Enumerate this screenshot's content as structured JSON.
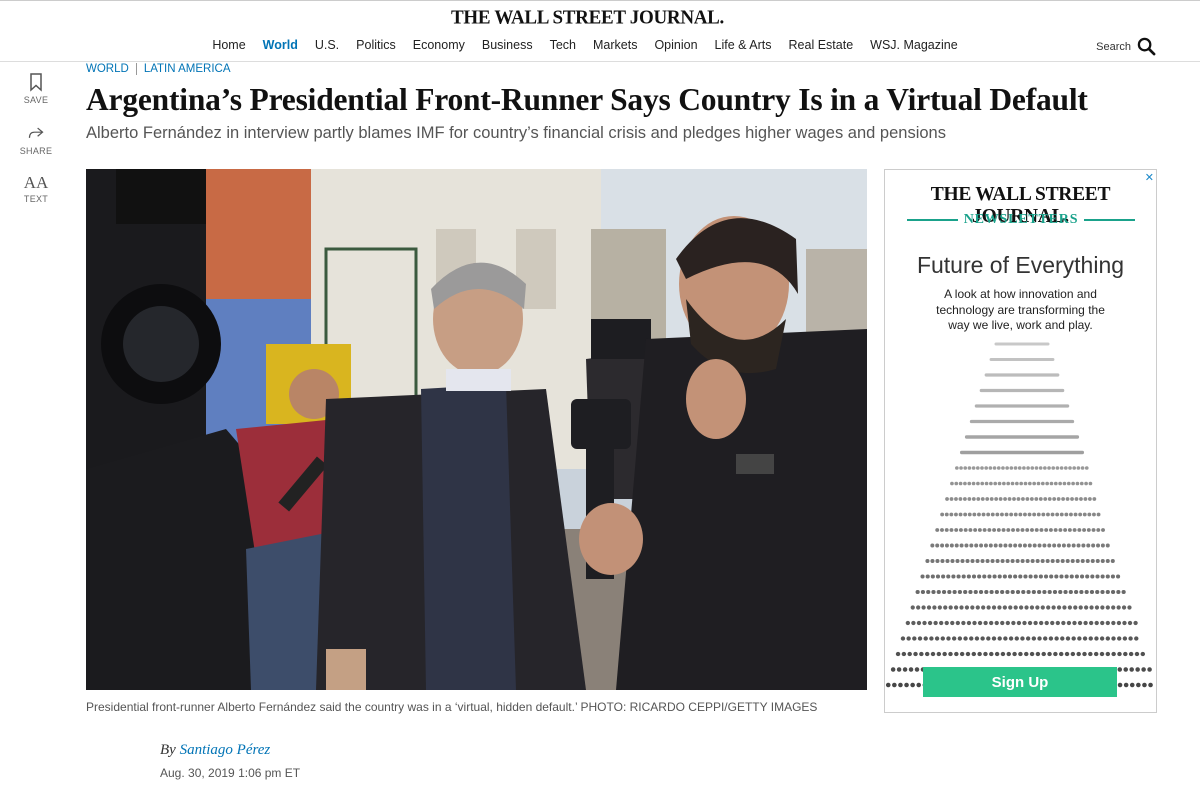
{
  "header": {
    "logo": "THE WALL STREET JOURNAL.",
    "nav": [
      "Home",
      "World",
      "U.S.",
      "Politics",
      "Economy",
      "Business",
      "Tech",
      "Markets",
      "Opinion",
      "Life & Arts",
      "Real Estate",
      "WSJ. Magazine"
    ],
    "active_nav": "World",
    "search_label": "Search",
    "search_icon": "magnifier-icon"
  },
  "tools": [
    {
      "label": "SAVE",
      "icon": "bookmark-icon"
    },
    {
      "label": "SHARE",
      "icon": "share-arrow-icon"
    },
    {
      "label": "TEXT",
      "icon": "text-size-icon",
      "glyph": "AA"
    }
  ],
  "article": {
    "section": "WORLD",
    "subsection": "LATIN AMERICA",
    "headline": "Argentina’s Presidential Front-Runner Says Country Is in a Virtual Default",
    "dek": "Alberto Fernández in interview partly blames IMF for country’s financial crisis and pledges higher wages and pensions",
    "caption": "Presidential front-runner Alberto Fernández said the country was in a ‘virtual, hidden default.’ PHOTO: RICARDO CEPPI/GETTY IMAGES",
    "byline_prefix": "By",
    "author": "Santiago Pérez",
    "date": "Aug. 30, 2019 1:06 pm ET"
  },
  "ad": {
    "logo": "THE WALL STREET JOURNAL.",
    "label": "NEWSLETTERS",
    "title": "Future of Everything",
    "subtitle": "A look at how innovation and technology are transforming the way we live, work and play.",
    "cta": "Sign Up",
    "accent": "#1aa28b",
    "cta_color": "#2bc48a"
  },
  "colors": {
    "link": "#0274b6"
  }
}
